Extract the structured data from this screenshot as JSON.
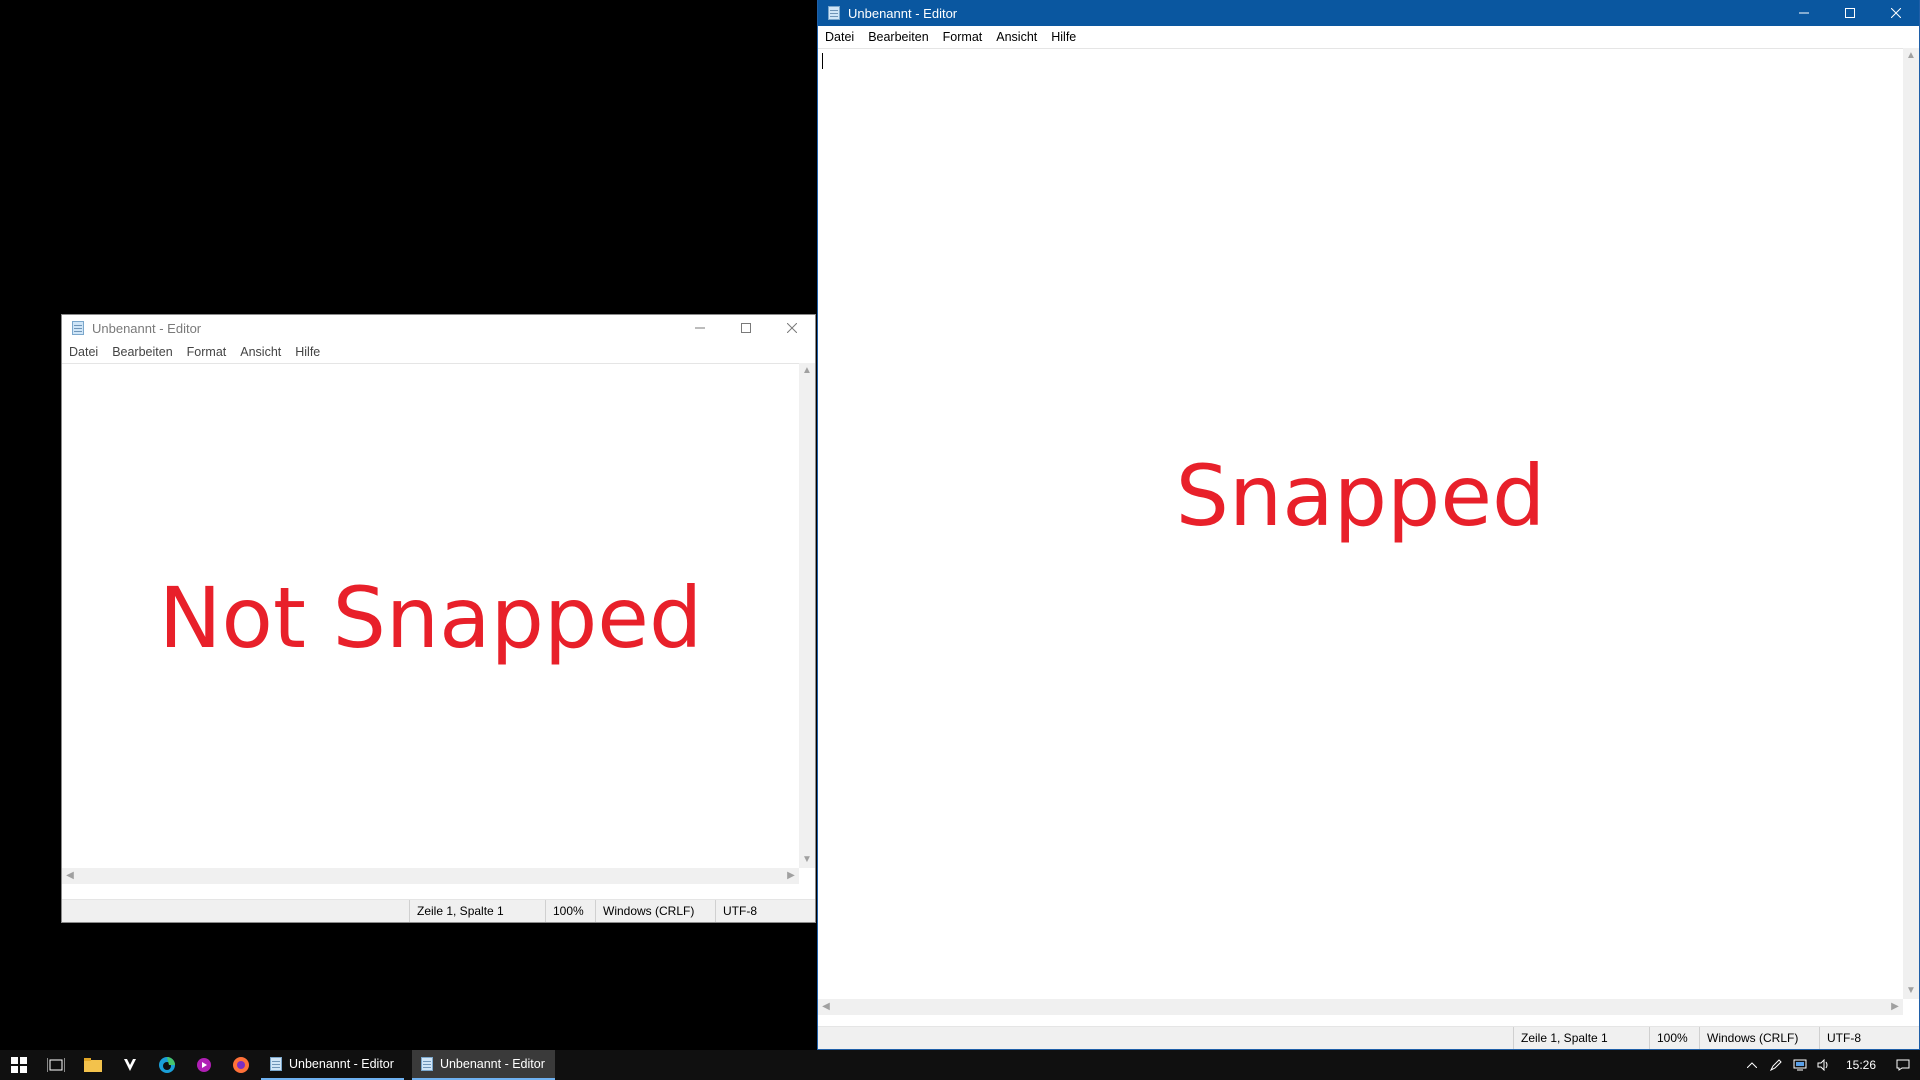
{
  "windows": {
    "left": {
      "title": "Unbenannt - Editor",
      "menu": [
        "Datei",
        "Bearbeiten",
        "Format",
        "Ansicht",
        "Hilfe"
      ],
      "overlay_text": "Not Snapped",
      "status": {
        "position": "Zeile 1, Spalte 1",
        "zoom": "100%",
        "line_ending": "Windows (CRLF)",
        "encoding": "UTF-8"
      }
    },
    "right": {
      "title": "Unbenannt - Editor",
      "menu": [
        "Datei",
        "Bearbeiten",
        "Format",
        "Ansicht",
        "Hilfe"
      ],
      "overlay_text": "Snapped",
      "status": {
        "position": "Zeile 1, Spalte 1",
        "zoom": "100%",
        "line_ending": "Windows (CRLF)",
        "encoding": "UTF-8"
      }
    }
  },
  "taskbar": {
    "pinned_icons": [
      "windows-start-icon",
      "task-view-icon",
      "file-explorer-icon",
      "shield-app-icon",
      "edge-icon",
      "media-player-icon",
      "firefox-icon"
    ],
    "apps": [
      {
        "label": "Unbenannt - Editor",
        "active": false
      },
      {
        "label": "Unbenannt - Editor",
        "active": true
      }
    ],
    "tray_icons": [
      "show-hidden-icons-icon",
      "pen-icon",
      "network-icon",
      "volume-icon",
      "notification-icon"
    ],
    "clock": "15:26"
  },
  "colors": {
    "overlay_red": "#e8202a",
    "active_titlebar": "#0a57a0",
    "taskbar": "#101010"
  }
}
